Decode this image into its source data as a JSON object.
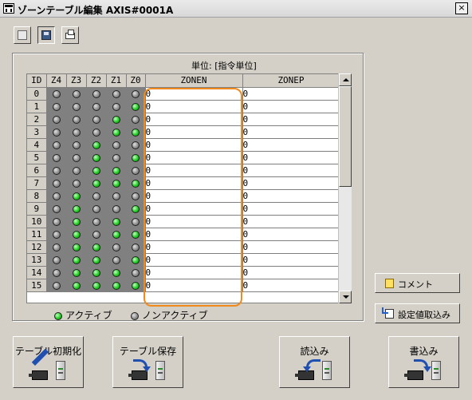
{
  "window": {
    "title": "ゾーンテーブル編集 AXIS#0001A",
    "close_label": "×"
  },
  "toolbar": {
    "icons": [
      "new-icon",
      "save-icon",
      "print-icon"
    ]
  },
  "table": {
    "unit_label": "単位: [指令単位]",
    "headers": {
      "id": "ID",
      "z4": "Z4",
      "z3": "Z3",
      "z2": "Z2",
      "z1": "Z1",
      "z0": "Z0",
      "zonen": "ZONEN",
      "zonep": "ZONEP"
    },
    "rows": [
      {
        "id": "0",
        "zones": [
          0,
          0,
          0,
          0,
          0
        ],
        "zonen": "0",
        "zonep": "0"
      },
      {
        "id": "1",
        "zones": [
          0,
          0,
          0,
          0,
          1
        ],
        "zonen": "0",
        "zonep": "0"
      },
      {
        "id": "2",
        "zones": [
          0,
          0,
          0,
          1,
          0
        ],
        "zonen": "0",
        "zonep": "0"
      },
      {
        "id": "3",
        "zones": [
          0,
          0,
          0,
          1,
          1
        ],
        "zonen": "0",
        "zonep": "0"
      },
      {
        "id": "4",
        "zones": [
          0,
          0,
          1,
          0,
          0
        ],
        "zonen": "0",
        "zonep": "0"
      },
      {
        "id": "5",
        "zones": [
          0,
          0,
          1,
          0,
          1
        ],
        "zonen": "0",
        "zonep": "0"
      },
      {
        "id": "6",
        "zones": [
          0,
          0,
          1,
          1,
          0
        ],
        "zonen": "0",
        "zonep": "0"
      },
      {
        "id": "7",
        "zones": [
          0,
          0,
          1,
          1,
          1
        ],
        "zonen": "0",
        "zonep": "0"
      },
      {
        "id": "8",
        "zones": [
          0,
          1,
          0,
          0,
          0
        ],
        "zonen": "0",
        "zonep": "0"
      },
      {
        "id": "9",
        "zones": [
          0,
          1,
          0,
          0,
          1
        ],
        "zonen": "0",
        "zonep": "0"
      },
      {
        "id": "10",
        "zones": [
          0,
          1,
          0,
          1,
          0
        ],
        "zonen": "0",
        "zonep": "0"
      },
      {
        "id": "11",
        "zones": [
          0,
          1,
          0,
          1,
          1
        ],
        "zonen": "0",
        "zonep": "0"
      },
      {
        "id": "12",
        "zones": [
          0,
          1,
          1,
          0,
          0
        ],
        "zonen": "0",
        "zonep": "0"
      },
      {
        "id": "13",
        "zones": [
          0,
          1,
          1,
          0,
          1
        ],
        "zonen": "0",
        "zonep": "0"
      },
      {
        "id": "14",
        "zones": [
          0,
          1,
          1,
          1,
          0
        ],
        "zonen": "0",
        "zonep": "0"
      },
      {
        "id": "15",
        "zones": [
          0,
          1,
          1,
          1,
          1
        ],
        "zonen": "0",
        "zonep": "0"
      }
    ]
  },
  "legend": {
    "active": "アクティブ",
    "inactive": "ノンアクティブ"
  },
  "side_buttons": {
    "comment": "コメント",
    "import_settings": "設定値取込み"
  },
  "bottom_buttons": {
    "init": "テーブル初期化",
    "save": "テーブル保存",
    "read": "読込み",
    "write": "書込み"
  },
  "colors": {
    "active_led": "#17c917",
    "inactive_led": "#8a8a8a",
    "highlight": "#f08a1c"
  }
}
